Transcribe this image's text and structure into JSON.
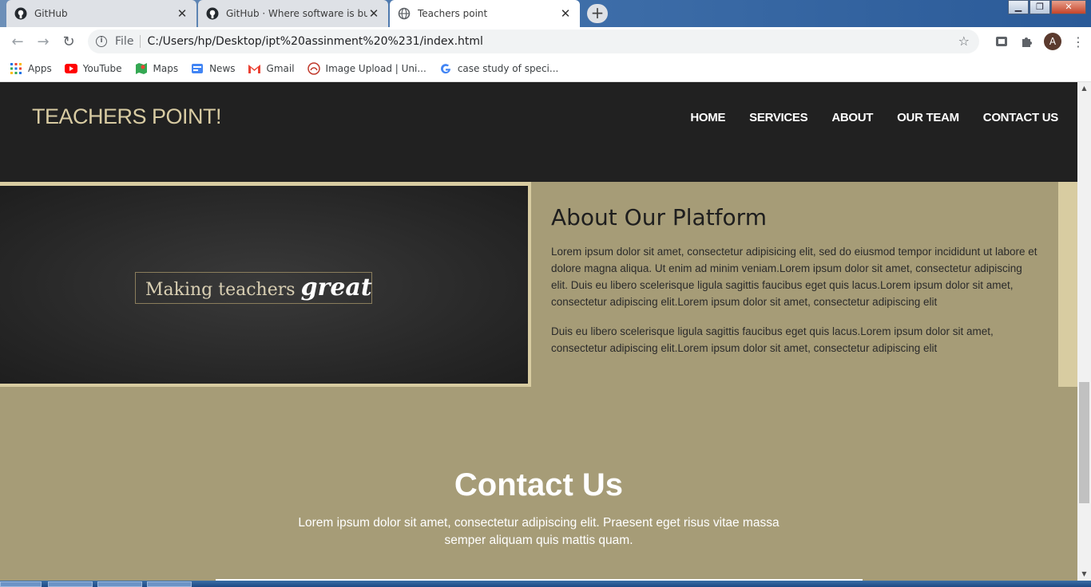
{
  "browser": {
    "tabs": [
      {
        "title": "GitHub",
        "icon": "github-icon"
      },
      {
        "title": "GitHub · Where software is built",
        "icon": "github-icon"
      },
      {
        "title": "Teachers point",
        "icon": "globe-icon"
      }
    ],
    "url_scheme_label": "File",
    "url": "C:/Users/hp/Desktop/ipt%20assinment%20%231/index.html",
    "profile_initial": "A",
    "bookmarks": [
      {
        "label": "Apps",
        "icon": "apps-grid-icon"
      },
      {
        "label": "YouTube",
        "icon": "youtube-icon"
      },
      {
        "label": "Maps",
        "icon": "maps-icon"
      },
      {
        "label": "News",
        "icon": "news-icon"
      },
      {
        "label": "Gmail",
        "icon": "gmail-icon"
      },
      {
        "label": "Image Upload | Uni...",
        "icon": "image-upload-icon"
      },
      {
        "label": "case study of speci...",
        "icon": "google-icon"
      }
    ]
  },
  "site": {
    "logo": "TEACHERS POINT!",
    "nav": [
      "HOME",
      "SERVICES",
      "ABOUT",
      "OUR TEAM",
      "CONTACT US"
    ],
    "about": {
      "image_text": "Making teachers",
      "image_text_script": "great",
      "title": "About Our Platform",
      "paragraph1": "Lorem ipsum dolor sit amet, consectetur adipisicing elit, sed do eiusmod tempor incididunt ut labore et dolore magna aliqua. Ut enim ad minim veniam.Lorem ipsum dolor sit amet, consectetur adipiscing elit. Duis eu libero scelerisque ligula sagittis faucibus eget quis lacus.Lorem ipsum dolor sit amet, consectetur adipiscing elit.Lorem ipsum dolor sit amet, consectetur adipiscing elit",
      "paragraph2": "Duis eu libero scelerisque ligula sagittis faucibus eget quis lacus.Lorem ipsum dolor sit amet, consectetur adipiscing elit.Lorem ipsum dolor sit amet, consectetur adipiscing elit"
    },
    "contact": {
      "title": "Contact Us",
      "text": "Lorem ipsum dolor sit amet, consectetur adipiscing elit. Praesent eget risus vitae massa semper aliquam quis mattis quam."
    }
  },
  "colors": {
    "header_bg": "#212121",
    "logo": "#d8cba2",
    "section_bg": "#a69c77",
    "accent_border": "#d8cca1"
  }
}
